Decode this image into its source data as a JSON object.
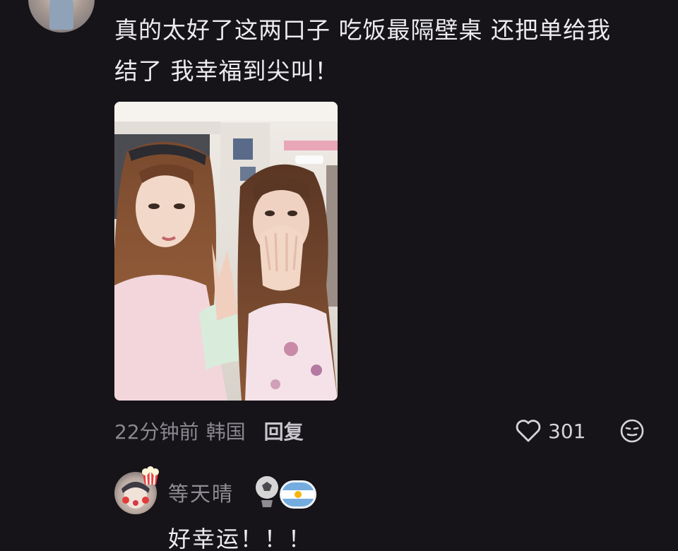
{
  "comment": {
    "line1": "真的太好了这两口子 吃饭最隔壁桌 还把单给我",
    "line2": "结了 我幸福到尖叫！",
    "time": "22分钟前",
    "region": "韩国",
    "reply_label": "回复",
    "like_count": "301",
    "icons": [
      "heart-icon",
      "emoji-icon"
    ]
  },
  "reply": {
    "username": "等天晴",
    "text": "好幸运！！！",
    "badges": [
      "soccer-ball-icon",
      "argentina-flag-icon"
    ]
  },
  "colors": {
    "background": "#161418",
    "text_primary": "#ecebee",
    "text_secondary": "#8a888e"
  }
}
